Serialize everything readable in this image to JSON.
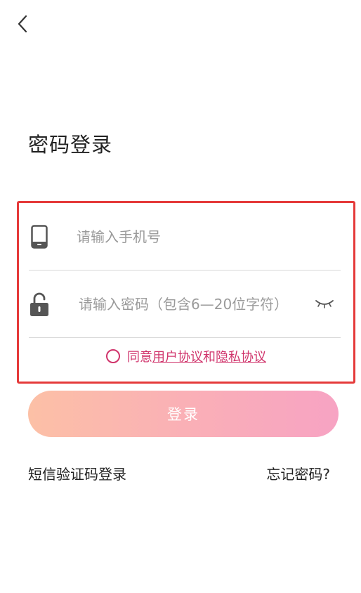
{
  "header": {
    "back_icon": "chevron-left-icon"
  },
  "title": "密码登录",
  "form": {
    "phone": {
      "icon": "phone-icon",
      "placeholder": "请输入手机号",
      "value": ""
    },
    "password": {
      "icon": "unlock-icon",
      "placeholder": "请输入密码（包含6—20位字符）",
      "value": "",
      "toggle_icon": "eye-closed-icon"
    },
    "agreement": {
      "prefix": "同意",
      "user_agreement": "用户协议",
      "conjunction": "和",
      "privacy_agreement": "隐私协议"
    }
  },
  "login_button": "登录",
  "links": {
    "sms_login": "短信验证码登录",
    "forgot_password": "忘记密码?"
  },
  "colors": {
    "highlight_border": "#e53a3a",
    "accent": "#d0336b",
    "button_gradient_start": "#fcc0a6",
    "button_gradient_end": "#f7a3c3"
  }
}
